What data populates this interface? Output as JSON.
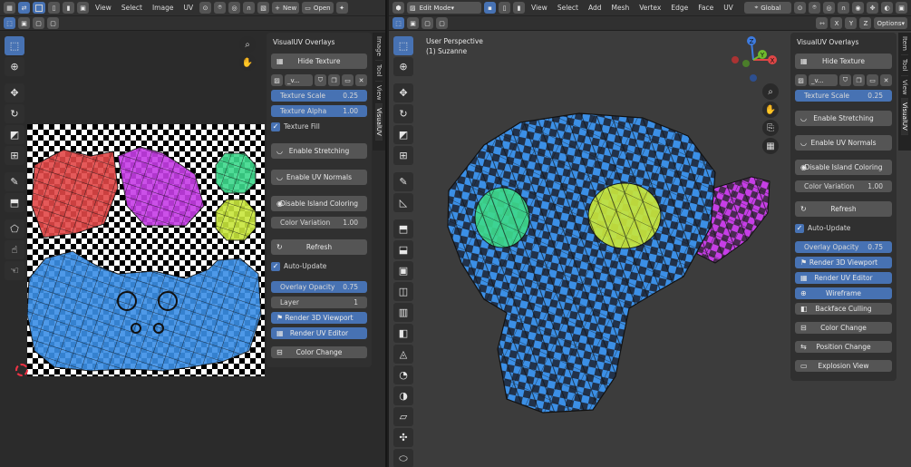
{
  "uv_editor": {
    "menus": [
      "View",
      "Select",
      "Image",
      "UV"
    ],
    "new_label": "New",
    "open_label": "Open",
    "sidebar_tabs": [
      "Image",
      "Tool",
      "View",
      "VisualUV"
    ],
    "panel": {
      "title": "VisualUV Overlays",
      "hide_texture": "Hide Texture",
      "image_name": "_v...",
      "texture_scale_label": "Texture Scale",
      "texture_scale_value": "0.25",
      "texture_alpha_label": "Texture Alpha",
      "texture_alpha_value": "1.00",
      "texture_fill": "Texture Fill",
      "enable_stretching": "Enable Stretching",
      "enable_uv_normals": "Enable UV Normals",
      "disable_island_coloring": "Disable Island Coloring",
      "color_variation_label": "Color Variation",
      "color_variation_value": "1.00",
      "refresh": "Refresh",
      "auto_update": "Auto-Update",
      "overlay_opacity_label": "Overlay Opacity",
      "overlay_opacity_value": "0.75",
      "layer_label": "Layer",
      "layer_value": "1",
      "render_3d_viewport": "Render 3D Viewport",
      "render_uv_editor": "Render UV Editor",
      "color_change": "Color Change"
    }
  },
  "view3d": {
    "mode": "Edit Mode",
    "menus": [
      "View",
      "Select",
      "Add",
      "Mesh",
      "Vertex",
      "Edge",
      "Face",
      "UV"
    ],
    "orientation": "Global",
    "options_label": "Options",
    "axes": [
      "X",
      "Y",
      "Z"
    ],
    "viewport_title": "User Perspective",
    "object_label": "(1) Suzanne",
    "gizmo_axes": [
      "X",
      "Y",
      "Z"
    ],
    "sidebar_tabs": [
      "Item",
      "Tool",
      "View",
      "VisualUV"
    ],
    "panel": {
      "title": "VisualUV Overlays",
      "hide_texture": "Hide Texture",
      "image_name": "_v...",
      "texture_scale_label": "Texture Scale",
      "texture_scale_value": "0.25",
      "enable_stretching": "Enable Stretching",
      "enable_uv_normals": "Enable UV Normals",
      "disable_island_coloring": "Disable Island Coloring",
      "color_variation_label": "Color Variation",
      "color_variation_value": "1.00",
      "refresh": "Refresh",
      "auto_update": "Auto-Update",
      "overlay_opacity_label": "Overlay Opacity",
      "overlay_opacity_value": "0.75",
      "render_3d_viewport": "Render 3D Viewport",
      "render_uv_editor": "Render UV Editor",
      "wireframe": "Wireframe",
      "backface_culling": "Backface Culling",
      "color_change": "Color Change",
      "position_change": "Position Change",
      "explosion_view": "Explosion View"
    }
  },
  "colors": {
    "accent": "#4772b3",
    "island_red": "#e24848",
    "island_magenta": "#c63ee6",
    "island_green": "#3ed98c",
    "island_yellow": "#c8e63c",
    "island_blue": "#3b8fe6"
  }
}
